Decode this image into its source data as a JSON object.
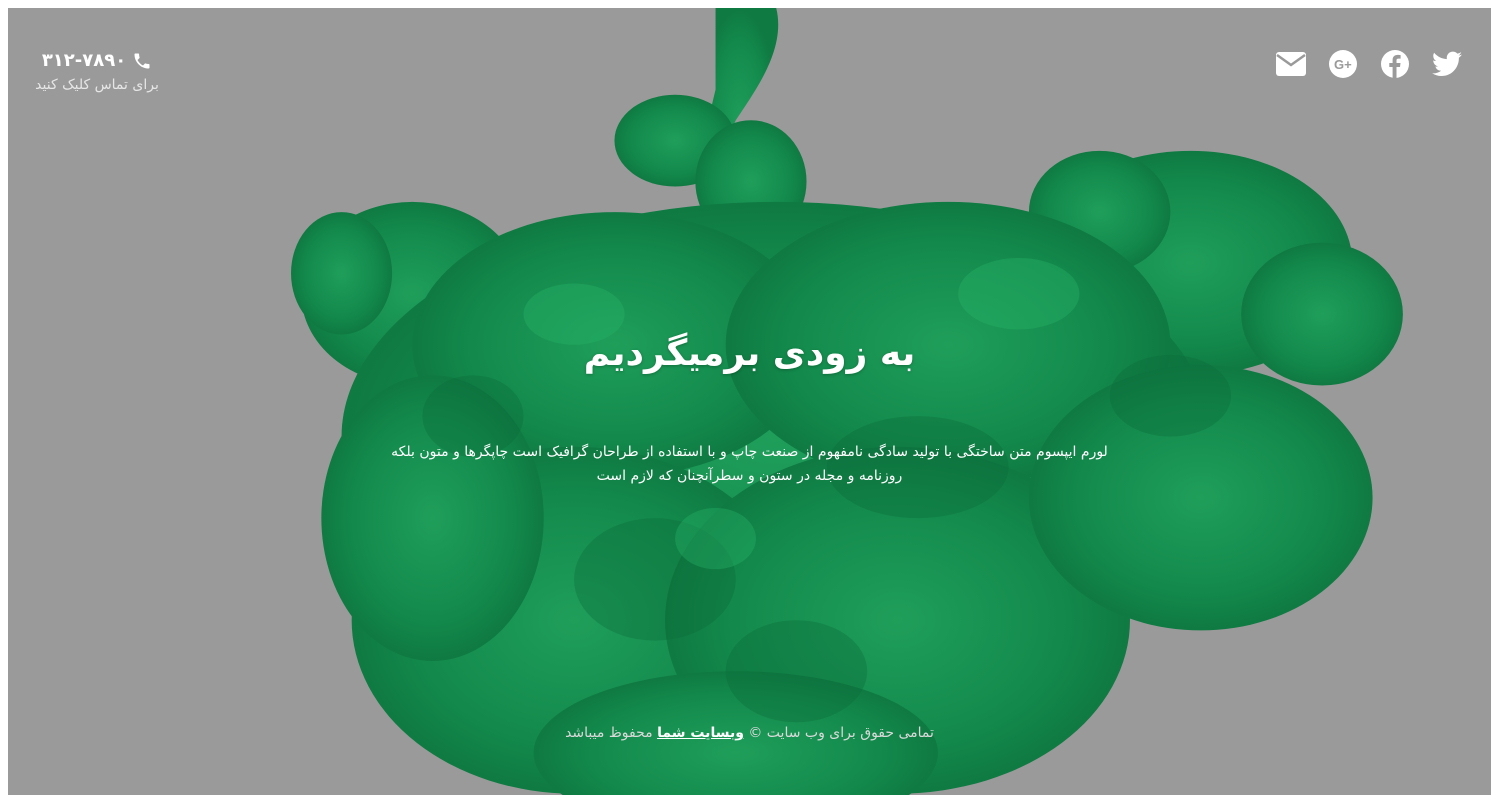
{
  "contact": {
    "phone": "۳۱۲-۷۸۹۰",
    "hint": "برای تماس کلیک کنید"
  },
  "social": {
    "icons": [
      "twitter-icon",
      "facebook-icon",
      "google-plus-icon",
      "mail-icon"
    ]
  },
  "hero": {
    "title": "به زودی برمیگردیم",
    "description": "لورم ایپسوم متن ساختگی با تولید سادگی نامفهوم از صنعت چاپ و با استفاده از طراحان گرافیک است چاپگرها و متون بلکه روزنامه و مجله در ستون و سطرآنچنان که لازم است"
  },
  "footer": {
    "prefix": "تمامی حقوق برای وب سایت ©",
    "link": "وبسایت شما",
    "suffix": "محفوظ میباشد"
  },
  "colors": {
    "background": "#9a9a9a",
    "ink": "#12874a",
    "text": "#ffffff"
  }
}
